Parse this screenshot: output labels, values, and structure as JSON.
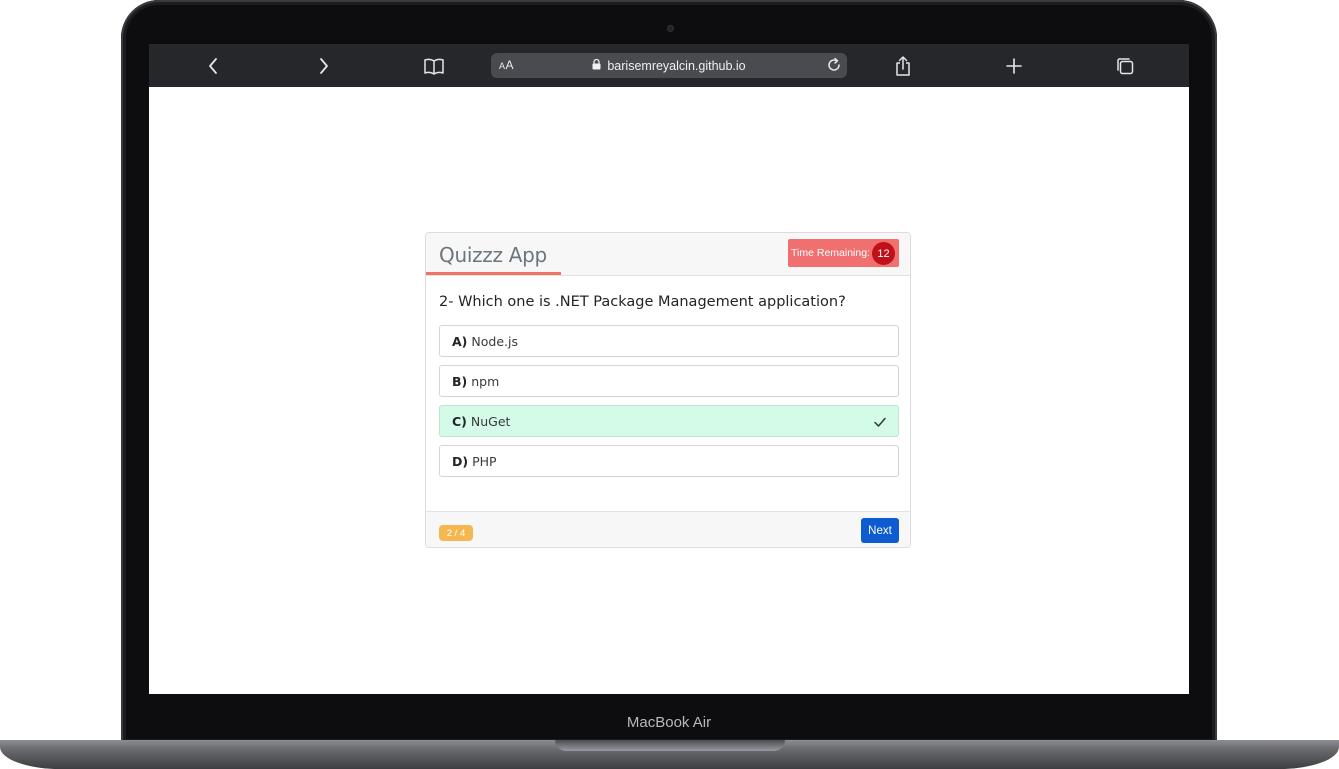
{
  "device": {
    "label": "MacBook Air"
  },
  "browser": {
    "address_prefix": "AA",
    "url": "barisemreyalcin.github.io",
    "icons": {
      "back": "chevron-left-icon",
      "forward": "chevron-right-icon",
      "bookmarks": "book-icon",
      "lock": "lock-icon",
      "reload": "reload-icon",
      "share": "share-icon",
      "new_tab": "plus-icon",
      "tabs": "tabs-icon"
    }
  },
  "quiz": {
    "app_title": "Quizzz App",
    "timer_label": "Time Remaining:",
    "timer_value": "12",
    "question": "2- Which one is .NET Package Management application?",
    "options": [
      {
        "letter": "A)",
        "text": "Node.js",
        "state": "default"
      },
      {
        "letter": "B)",
        "text": "npm",
        "state": "default"
      },
      {
        "letter": "C)",
        "text": "NuGet",
        "state": "correct"
      },
      {
        "letter": "D)",
        "text": "PHP",
        "state": "default"
      }
    ],
    "progress": "2 / 4",
    "next_label": "Next",
    "colors": {
      "accent_underline": "#ee7563",
      "timer_bg": "#f07070",
      "timer_badge": "#c0101a",
      "correct_bg": "#d3fbe7",
      "progress_badge": "#f5b74f",
      "next_button": "#0d5bd1"
    }
  }
}
